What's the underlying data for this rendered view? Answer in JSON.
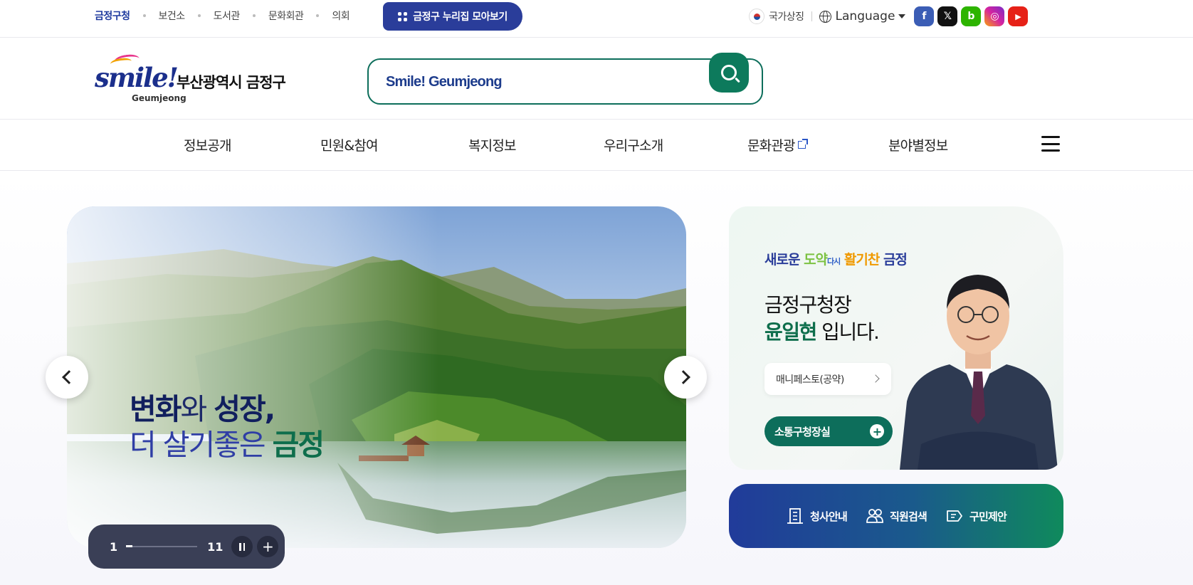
{
  "topbar": {
    "sites": [
      {
        "label": "금정구청",
        "active": true
      },
      {
        "label": "보건소",
        "active": false
      },
      {
        "label": "도서관",
        "active": false
      },
      {
        "label": "문화회관",
        "active": false
      },
      {
        "label": "의회",
        "active": false
      }
    ],
    "portal_button": "금정구 누리집 모아보기",
    "national_symbol": "국가상징",
    "language": "Language",
    "social": [
      {
        "icon": "facebook-icon",
        "glyph": "f",
        "color": "#3b5db5"
      },
      {
        "icon": "x-icon",
        "glyph": "𝕏",
        "color": "#111111"
      },
      {
        "icon": "blog-icon",
        "glyph": "b",
        "color": "#2db400"
      },
      {
        "icon": "instagram-icon",
        "glyph": "◎",
        "color": "#d6249f"
      },
      {
        "icon": "youtube-icon",
        "glyph": "▶",
        "color": "#e62117"
      }
    ]
  },
  "header": {
    "logo_main": "smile!",
    "logo_sub": "Geumjeong",
    "logo_name": "부산광역시 금정구",
    "search_placeholder": "Smile! Geumjeong"
  },
  "gnb": {
    "items": [
      {
        "label": "정보공개",
        "external": false
      },
      {
        "label": "민원&참여",
        "external": false
      },
      {
        "label": "복지정보",
        "external": false
      },
      {
        "label": "우리구소개",
        "external": false
      },
      {
        "label": "문화관광",
        "external": true
      },
      {
        "label": "분야별정보",
        "external": false
      }
    ]
  },
  "visual": {
    "line1_a": "변화",
    "line1_b": "와 ",
    "line1_c": "성장,",
    "line2_a": "더 살기좋은 ",
    "line2_b": "금정",
    "current": "1",
    "total": "11",
    "progress": 0.09
  },
  "mayor": {
    "slogan_1": "새로운 ",
    "slogan_2": "도약",
    "slogan_3": "다시",
    "slogan_4": " 활기찬 ",
    "slogan_5": "금정",
    "title_line1": "금정구청장",
    "name": "윤일현",
    "title_suffix": " 입니다.",
    "manifesto": "매니페스토(공약)",
    "communication": "소통구청장실"
  },
  "quick_links": [
    {
      "label": "청사안내",
      "icon": "building-icon"
    },
    {
      "label": "직원검색",
      "icon": "people-icon"
    },
    {
      "label": "구민제안",
      "icon": "proposal-icon"
    }
  ],
  "colors": {
    "brand_blue": "#2a3d9a",
    "brand_green": "#0d6e5b"
  }
}
